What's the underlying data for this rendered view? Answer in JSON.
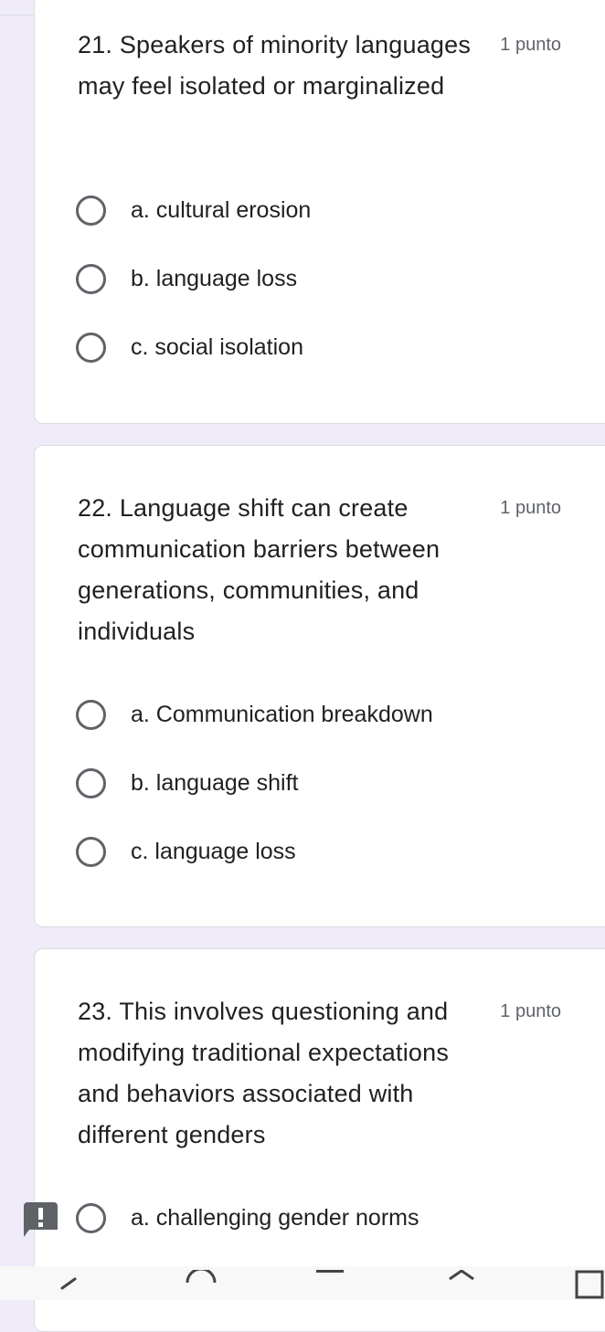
{
  "questions": [
    {
      "title": "21. Speakers of minority languages may feel isolated or marginalized",
      "points": "1 punto",
      "options": [
        "a. cultural erosion",
        "b. language loss",
        "c. social isolation"
      ]
    },
    {
      "title": "22. Language shift can create communication barriers between generations, communities, and individuals",
      "points": "1 punto",
      "options": [
        "a. Communication breakdown",
        "b. language shift",
        "c. language loss"
      ]
    },
    {
      "title": "23. This involves questioning and modifying traditional expectations and behaviors associated with different genders",
      "points": "1 punto",
      "options": [
        "a. challenging gender norms"
      ]
    }
  ],
  "icons": {
    "warning": "exclamation-icon",
    "nav_back": "back-icon",
    "nav_home": "home-icon",
    "nav_recents": "recents-icon"
  },
  "colors": {
    "page_background": "#f0ebf8",
    "card_background": "#ffffff",
    "text": "#202124",
    "secondary_text": "#5f6368"
  }
}
